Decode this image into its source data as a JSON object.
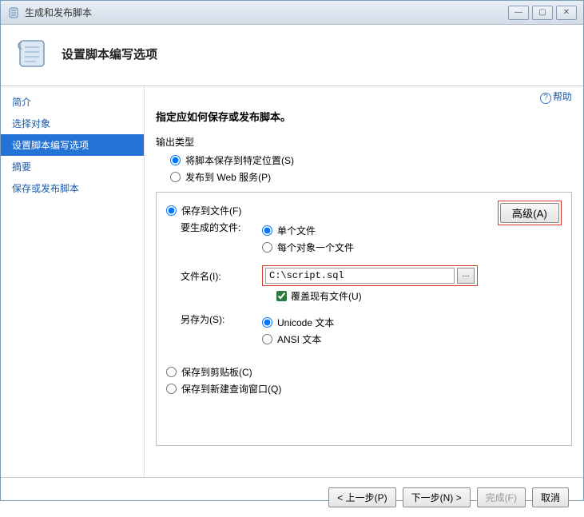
{
  "window": {
    "title": "生成和发布脚本"
  },
  "header": {
    "title": "设置脚本编写选项"
  },
  "help": {
    "label": "帮助"
  },
  "sidebar": {
    "items": [
      {
        "label": "简介"
      },
      {
        "label": "选择对象"
      },
      {
        "label": "设置脚本编写选项"
      },
      {
        "label": "摘要"
      },
      {
        "label": "保存或发布脚本"
      }
    ]
  },
  "main": {
    "section_title": "指定应如何保存或发布脚本。",
    "output_type_label": "输出类型",
    "output_type": {
      "save_location": "将脚本保存到特定位置(S)",
      "publish_web": "发布到 Web 服务(P)"
    },
    "advanced_btn": "高级(A)",
    "save_to_file": "保存到文件(F)",
    "files_to_generate_label": "要生成的文件:",
    "files_to_generate": {
      "single": "单个文件",
      "per_object": "每个对象一个文件"
    },
    "filename_label": "文件名(I):",
    "filename_value": "C:\\script.sql",
    "overwrite_label": "覆盖现有文件(U)",
    "save_as_label": "另存为(S):",
    "save_as": {
      "unicode": "Unicode 文本",
      "ansi": "ANSI 文本"
    },
    "save_clipboard": "保存到剪贴板(C)",
    "save_query": "保存到新建查询窗口(Q)"
  },
  "footer": {
    "prev": "< 上一步(P)",
    "next": "下一步(N) >",
    "finish": "完成(F)",
    "cancel": "取消"
  }
}
